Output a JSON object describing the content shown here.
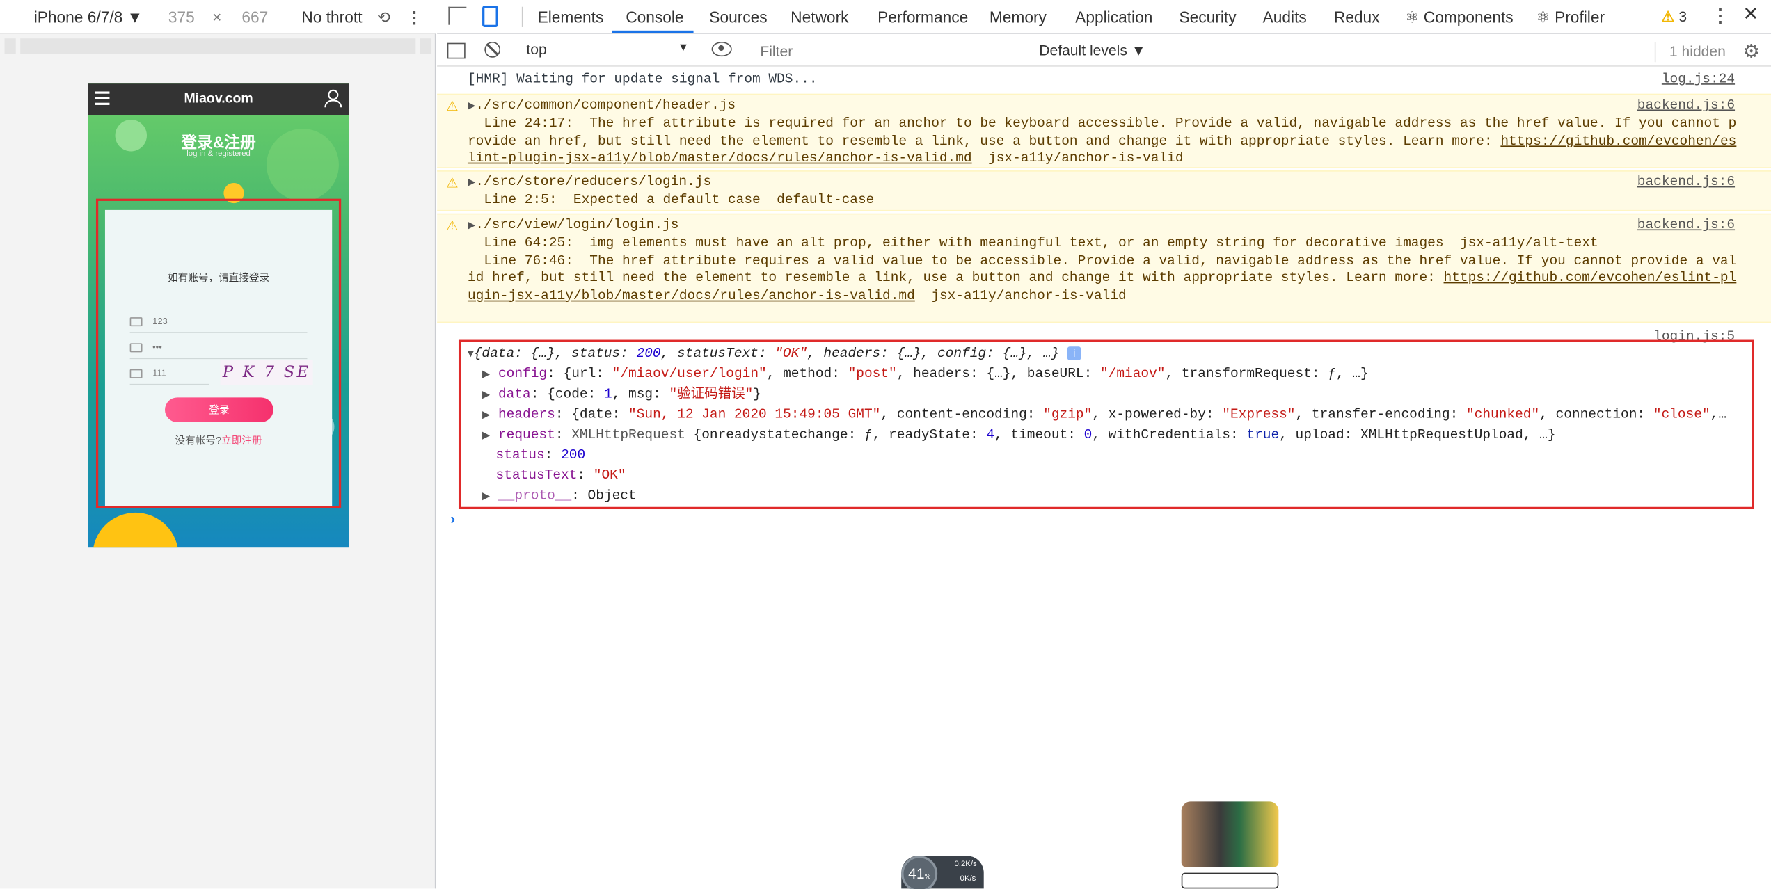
{
  "device_toolbar": {
    "device_name": "iPhone 6/7/8 ▼",
    "width": "375",
    "times": "×",
    "height": "667",
    "throttle": "No thrott",
    "rotate_glyph": "⟲",
    "more_glyph": "⋮"
  },
  "phone": {
    "brand": "Miaov.com",
    "title": "登录&注册",
    "subtitle": "log in & registered",
    "hint": "如有账号，请直接登录",
    "username": "123",
    "password": "•••",
    "captcha": "111",
    "captcha_text": "P K 7 SE",
    "login_button": "登录",
    "register_prompt": "没有帐号?",
    "register_link": "立即注册"
  },
  "devtools": {
    "tabs": [
      "Elements",
      "Console",
      "Sources",
      "Network",
      "Performance",
      "Memory",
      "Application",
      "Security",
      "Audits",
      "Redux",
      "⚛ Components",
      "⚛ Profiler"
    ],
    "active_tab": "Console",
    "warning_count": "3",
    "context": "top",
    "filter_placeholder": "Filter",
    "default_levels": "Default levels ▼",
    "hidden": "1 hidden",
    "accent_color": "#1a73e8",
    "warning_color": "#f2b705"
  },
  "console": {
    "hmr": {
      "text": "[HMR] Waiting for update signal from WDS...",
      "source": "log.js:24"
    },
    "warnings": [
      {
        "file": "./src/common/component/header.js",
        "source": "backend.js:6",
        "body": "  Line 24:17:  The href attribute is required for an anchor to be keyboard accessible. Provide a valid, navigable address as the href value. If you cannot provide an href, but still need the element to resemble a link, use a button and change it with appropriate styles. Learn more: ",
        "link": "https://github.com/evcohen/eslint-plugin-jsx-a11y/blob/master/docs/rules/anchor-is-valid.md",
        "rule": "  jsx-a11y/anchor-is-valid"
      },
      {
        "file": "./src/store/reducers/login.js",
        "source": "backend.js:6",
        "body": "  Line 2:5:  Expected a default case  default-case"
      },
      {
        "file": "./src/view/login/login.js",
        "source": "backend.js:6",
        "body": "  Line 64:25:  img elements must have an alt prop, either with meaningful text, or an empty string for decorative images  jsx-a11y/alt-text\n  Line 76:46:  The href attribute requires a valid value to be accessible. Provide a valid, navigable address as the href value. If you cannot provide a valid href, but still need the element to resemble a link, use a button and change it with appropriate styles. Learn more: ",
        "link": "https://github.com/evcohen/eslint-plugin-jsx-a11y/blob/master/docs/rules/anchor-is-valid.md",
        "rule": "  jsx-a11y/anchor-is-valid"
      }
    ],
    "object_log": {
      "source": "login.js:5",
      "summary_open": "{data: {…}, status: ",
      "summary_status": "200",
      "summary_mid": ", statusText: ",
      "summary_statustext": "\"OK\"",
      "summary_end": ", headers: {…}, config: {…}, …}",
      "info": "i",
      "config_key": "config",
      "config_val_1": ": {url: ",
      "config_url": "\"/miaov/user/login\"",
      "config_val_2": ", method: ",
      "config_method": "\"post\"",
      "config_val_3": ", headers: {…}, baseURL: ",
      "config_base": "\"/miaov\"",
      "config_val_4": ", transformRequest: ƒ, …}",
      "data_key": "data",
      "data_val_1": ": {code: ",
      "data_code": "1",
      "data_val_2": ", msg: ",
      "data_msg": "\"验证码错误\"",
      "data_val_3": "}",
      "headers_key": "headers",
      "headers_val_1": ": {date: ",
      "headers_date": "\"Sun, 12 Jan 2020 15:49:05 GMT\"",
      "headers_val_2": ", content-encoding: ",
      "headers_enc": "\"gzip\"",
      "headers_val_3": ", x-powered-by: ",
      "headers_pow": "\"Express\"",
      "headers_val_4": ", transfer-encoding: ",
      "headers_te": "\"chunked\"",
      "headers_val_5": ", connection: ",
      "headers_conn": "\"close\"",
      "headers_val_6": ",…",
      "request_key": "request",
      "request_val_1": ": ",
      "request_type": "XMLHttpRequest",
      "request_val_2": " {onreadystatechange: ƒ, readyState: ",
      "request_rs": "4",
      "request_val_3": ", timeout: ",
      "request_to": "0",
      "request_val_4": ", withCredentials: ",
      "request_wc": "true",
      "request_val_5": ", upload: XMLHttpRequestUpload, …}",
      "status_key": "status",
      "status_val": "200",
      "statustext_key": "statusText",
      "statustext_val": "\"OK\"",
      "proto_key": "__proto__",
      "proto_val": ": Object"
    },
    "prompt": "›"
  },
  "overlays": {
    "net_percent": "41",
    "net_percent_unit": "%",
    "net_up": "0.2K/s",
    "net_down": "0K/s"
  }
}
